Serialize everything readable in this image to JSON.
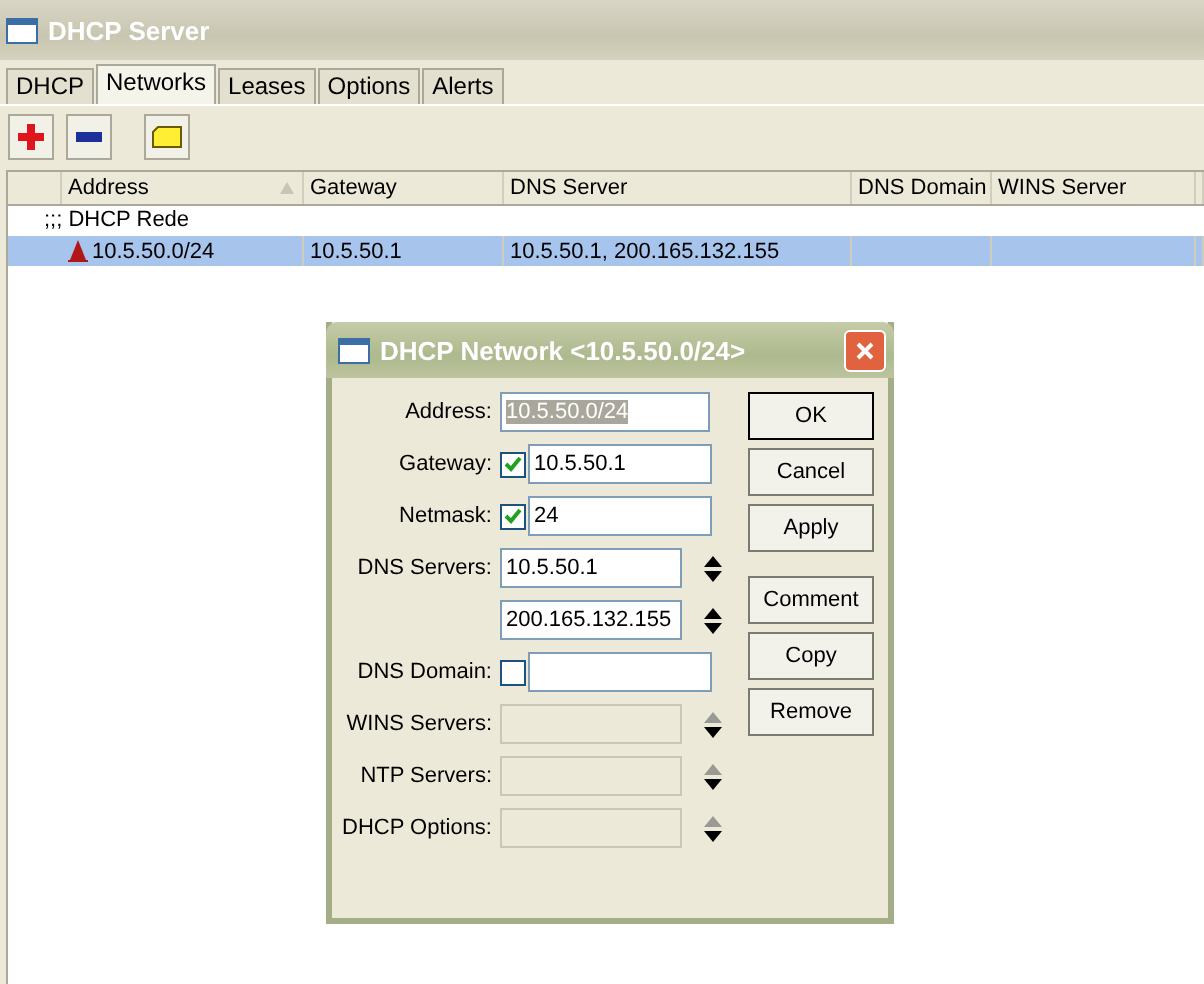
{
  "window": {
    "title": "DHCP Server"
  },
  "tabs": [
    {
      "label": "DHCP",
      "selected": false
    },
    {
      "label": "Networks",
      "selected": true
    },
    {
      "label": "Leases",
      "selected": false
    },
    {
      "label": "Options",
      "selected": false
    },
    {
      "label": "Alerts",
      "selected": false
    }
  ],
  "table": {
    "columns": [
      "Address",
      "Gateway",
      "DNS Server",
      "DNS Domain",
      "WINS Server"
    ],
    "rows": [
      {
        "kind": "comment",
        "text": ";;; DHCP Rede"
      },
      {
        "kind": "network",
        "selected": true,
        "cells": [
          "10.5.50.0/24",
          "10.5.50.1",
          "10.5.50.1, 200.165.132.155"
        ]
      }
    ]
  },
  "dialog": {
    "title": "DHCP Network <10.5.50.0/24>",
    "fields": [
      {
        "kind": "plain",
        "label": "Address:",
        "value": "10.5.50.0/24",
        "highlighted": true
      },
      {
        "kind": "checkbox",
        "label": "Gateway:",
        "checked": true,
        "value": "10.5.50.1"
      },
      {
        "kind": "checkbox",
        "label": "Netmask:",
        "checked": true,
        "value": "24"
      },
      {
        "kind": "list",
        "label": "DNS Servers:",
        "disabled": false,
        "values": [
          "10.5.50.1",
          "200.165.132.155"
        ]
      },
      {
        "kind": "checkbox",
        "label": "DNS Domain:",
        "checked": false
      },
      {
        "kind": "list",
        "label": "WINS Servers:",
        "disabled": true
      },
      {
        "kind": "list",
        "label": "NTP Servers:",
        "disabled": true
      },
      {
        "kind": "list",
        "label": "DHCP Options:",
        "disabled": true
      }
    ],
    "buttons": [
      [
        {
          "label": "OK",
          "default": true
        },
        {
          "label": "Cancel",
          "default": false
        },
        {
          "label": "Apply",
          "default": false
        }
      ],
      [
        {
          "label": "Comment",
          "default": false
        },
        {
          "label": "Copy",
          "default": false
        },
        {
          "label": "Remove",
          "default": false
        }
      ]
    ]
  }
}
